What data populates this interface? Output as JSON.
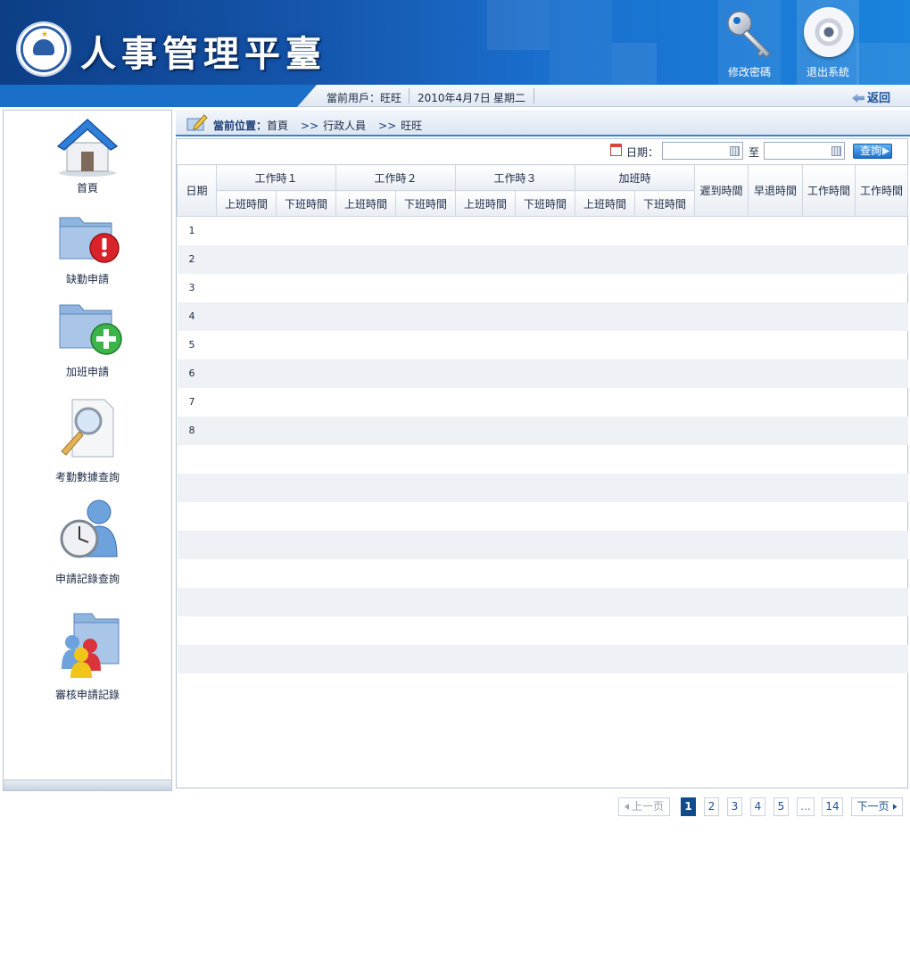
{
  "header": {
    "app_title": "人事管理平臺",
    "change_password_label": "修改密碼",
    "logout_label": "退出系統",
    "accent_color": "#1a6fcd"
  },
  "userbar": {
    "current_user": "當前用戶：旺旺",
    "date": "2010年4月7日",
    "weekday": "星期二",
    "back_label": "返回"
  },
  "sidebar": {
    "items": [
      {
        "label": "首頁",
        "icon": "home-icon"
      },
      {
        "label": "缺勤申請",
        "icon": "folder-alert-icon"
      },
      {
        "label": "加班申請",
        "icon": "folder-add-icon"
      },
      {
        "label": "考勤數據查詢",
        "icon": "search-document-icon"
      },
      {
        "label": "申請記錄查詢",
        "icon": "user-clock-icon"
      },
      {
        "label": "審核申請記錄",
        "icon": "users-folder-icon"
      }
    ]
  },
  "breadcrumb": {
    "prefix": "當前位置：",
    "items": [
      "首頁",
      "行政人員",
      "旺旺"
    ],
    "separator": ">>"
  },
  "search": {
    "date_label": "日期：",
    "to_label": "至",
    "from_value": "",
    "to_value": "",
    "query_label": "查詢"
  },
  "table": {
    "date_header": "日期",
    "groups": [
      "工作時１",
      "工作時２",
      "工作時３",
      "加班時"
    ],
    "sub_headers": [
      "上班時間",
      "下班時間"
    ],
    "extra_headers": [
      "遲到時間",
      "早退時間",
      "工作時間",
      "工作時間"
    ],
    "rows": [
      "1",
      "2",
      "3",
      "4",
      "5",
      "6",
      "7",
      "8",
      "",
      "",
      "",
      "",
      "",
      "",
      "",
      ""
    ]
  },
  "pagination": {
    "prev_label": "上一页",
    "next_label": "下一页",
    "pages": [
      "1",
      "2",
      "3",
      "4",
      "5",
      "...",
      "14"
    ],
    "current": "1"
  }
}
